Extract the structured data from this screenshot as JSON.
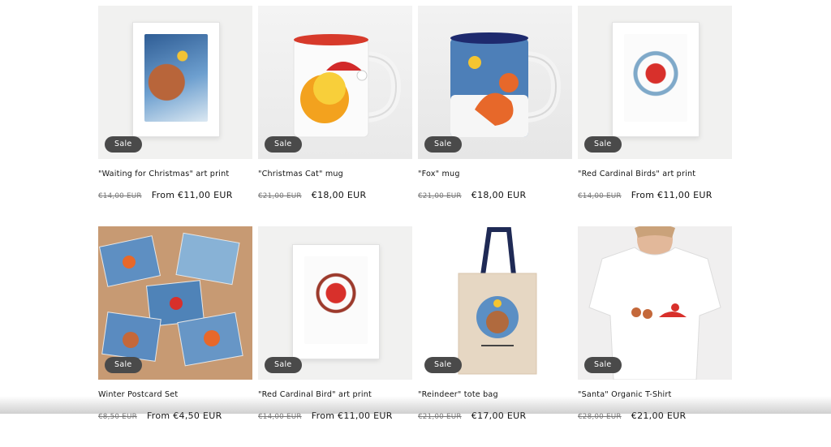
{
  "products": [
    {
      "title": "\"Waiting for Christmas\" art print",
      "compare_price": "€14,00 EUR",
      "price": "From €11,00 EUR",
      "badge": "Sale",
      "image": "framed-print-bear"
    },
    {
      "title": "\"Christmas Cat\" mug",
      "compare_price": "€21,00 EUR",
      "price": "€18,00 EUR",
      "badge": "Sale",
      "image": "mug-red-cat"
    },
    {
      "title": "\"Fox\" mug",
      "compare_price": "€21,00 EUR",
      "price": "€18,00 EUR",
      "badge": "Sale",
      "image": "mug-blue-fox"
    },
    {
      "title": "\"Red Cardinal Birds\" art print",
      "compare_price": "€14,00 EUR",
      "price": "From €11,00 EUR",
      "badge": "Sale",
      "image": "framed-print-cardinals"
    },
    {
      "title": "Winter Postcard Set",
      "compare_price": "€8,50 EUR",
      "price": "From €4,50 EUR",
      "badge": "Sale",
      "image": "postcards"
    },
    {
      "title": "\"Red Cardinal Bird\" art print",
      "compare_price": "€14,00 EUR",
      "price": "From €11,00 EUR",
      "badge": "Sale",
      "image": "framed-print-cardinal"
    },
    {
      "title": "\"Reindeer\" tote bag",
      "compare_price": "€21,00 EUR",
      "price": "€17,00 EUR",
      "badge": "Sale",
      "image": "tote-bag-reindeer"
    },
    {
      "title": "\"Santa\" Organic T-Shirt",
      "compare_price": "€28,00 EUR",
      "price": "€21,00 EUR",
      "badge": "Sale",
      "image": "tshirt-santa"
    }
  ]
}
